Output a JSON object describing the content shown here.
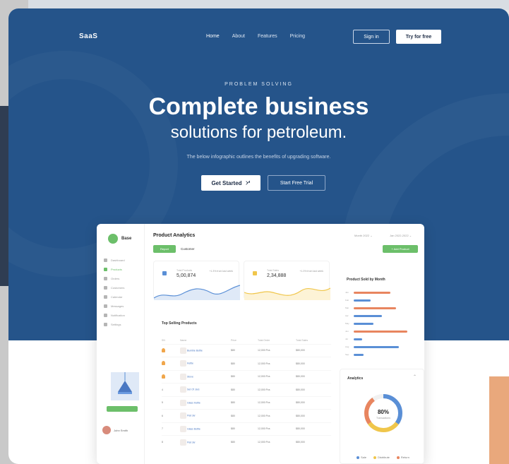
{
  "nav": {
    "logo": "SaaS",
    "links": [
      "Home",
      "About",
      "Features",
      "Pricing"
    ],
    "signin": "Sign in",
    "try_free": "Try for free"
  },
  "hero": {
    "kicker": "PROBLEM SOLVING",
    "title_line1": "Complete business",
    "title_line2": "solutions for petroleum.",
    "subtitle": "The below infographic outlines the benefits of upgrading software.",
    "cta_primary": "Get Started",
    "cta_secondary": "Start Free Trial"
  },
  "dashboard": {
    "brand": "Base",
    "title": "Product Analytics",
    "tabs": [
      "Report",
      "Customer"
    ],
    "select1": "Month 2022 ⌄",
    "select2": "Jan 2022-2022 ⌄",
    "add_button": "+ Add Product",
    "sidebar_items": [
      "Dashboard",
      "Products",
      "Orders",
      "Customers",
      "Calendar",
      "Messages",
      "Notification",
      "Settings"
    ],
    "kpis": [
      {
        "label": "Total Products",
        "value": "5,00,874",
        "trend": "+1.3% from last week",
        "color": "#5a8fd6"
      },
      {
        "label": "Total Sales",
        "value": "2,34,888",
        "trend": "+1.3% from last week",
        "color": "#f0c64b"
      }
    ],
    "top_selling_title": "Top Selling Products",
    "table_headers": [
      "SN",
      "Name",
      "Price",
      "Total Order",
      "Total Sales"
    ],
    "products": [
      {
        "sn": "1",
        "name": "Bumble Bottle",
        "price": "$80",
        "orders": "12,000 Pcs",
        "sales": "$80,000"
      },
      {
        "sn": "2",
        "name": "Kettle",
        "price": "$80",
        "orders": "12,000 Pcs",
        "sales": "$80,000"
      },
      {
        "sn": "3",
        "name": "Stove",
        "price": "$80",
        "orders": "12,000 Pcs",
        "sales": "$80,000"
      },
      {
        "sn": "4",
        "name": "Set Of Jars",
        "price": "$80",
        "orders": "12,000 Pcs",
        "sales": "$80,000"
      },
      {
        "sn": "5",
        "name": "Glass Kettle",
        "price": "$80",
        "orders": "12,000 Pcs",
        "sales": "$80,000"
      },
      {
        "sn": "6",
        "name": "Flat Jar",
        "price": "$80",
        "orders": "12,000 Pcs",
        "sales": "$80,000"
      },
      {
        "sn": "7",
        "name": "Glass Bottle",
        "price": "$80",
        "orders": "12,000 Pcs",
        "sales": "$80,000"
      },
      {
        "sn": "8",
        "name": "Flat Jar",
        "price": "$80",
        "orders": "12,000 Pcs",
        "sales": "$80,000"
      }
    ],
    "product_sold_title": "Product Sold by Month",
    "sold_bars": [
      {
        "label": "Jan",
        "value": 0.65,
        "color": "#e8855f"
      },
      {
        "label": "Feb",
        "value": 0.3,
        "color": "#5a8fd6"
      },
      {
        "label": "Mar",
        "value": 0.75,
        "color": "#e8855f"
      },
      {
        "label": "Apr",
        "value": 0.5,
        "color": "#5a8fd6"
      },
      {
        "label": "May",
        "value": 0.35,
        "color": "#5a8fd6"
      },
      {
        "label": "Jun",
        "value": 0.95,
        "color": "#e8855f"
      },
      {
        "label": "Jul",
        "value": 0.15,
        "color": "#5a8fd6"
      },
      {
        "label": "Aug",
        "value": 0.8,
        "color": "#5a8fd6"
      },
      {
        "label": "Sep",
        "value": 0.18,
        "color": "#5a8fd6"
      }
    ],
    "analytics_title": "Analytics",
    "donut_value": "80%",
    "donut_label": "Transactions",
    "donut_segments": [
      {
        "name": "Sale",
        "fraction": 0.35,
        "color": "#5a8fd6"
      },
      {
        "name": "Distribute",
        "fraction": 0.3,
        "color": "#f0c64b"
      },
      {
        "name": "Return",
        "fraction": 0.25,
        "color": "#e8855f"
      }
    ],
    "user_name": "John Smith"
  }
}
